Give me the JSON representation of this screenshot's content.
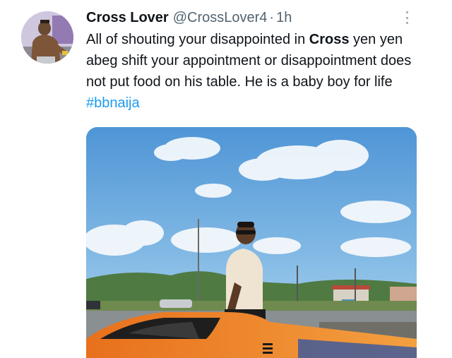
{
  "tweet": {
    "display_name": "Cross Lover",
    "handle": "@CrossLover4",
    "separator": "·",
    "time": "1h",
    "text_part1": "All of shouting your disappointed in ",
    "text_bold": "Cross",
    "text_part2": " yen yen  abeg shift your appointment or disappointment does not put food on his table. He is a baby boy for life ",
    "hashtag": "#bbnaija"
  },
  "icons": {
    "more": "more-options-icon",
    "avatar": "profile-avatar"
  },
  "colors": {
    "hashtag": "#1d9bf0",
    "secondary_text": "#536471",
    "primary_text": "#0f1419"
  }
}
